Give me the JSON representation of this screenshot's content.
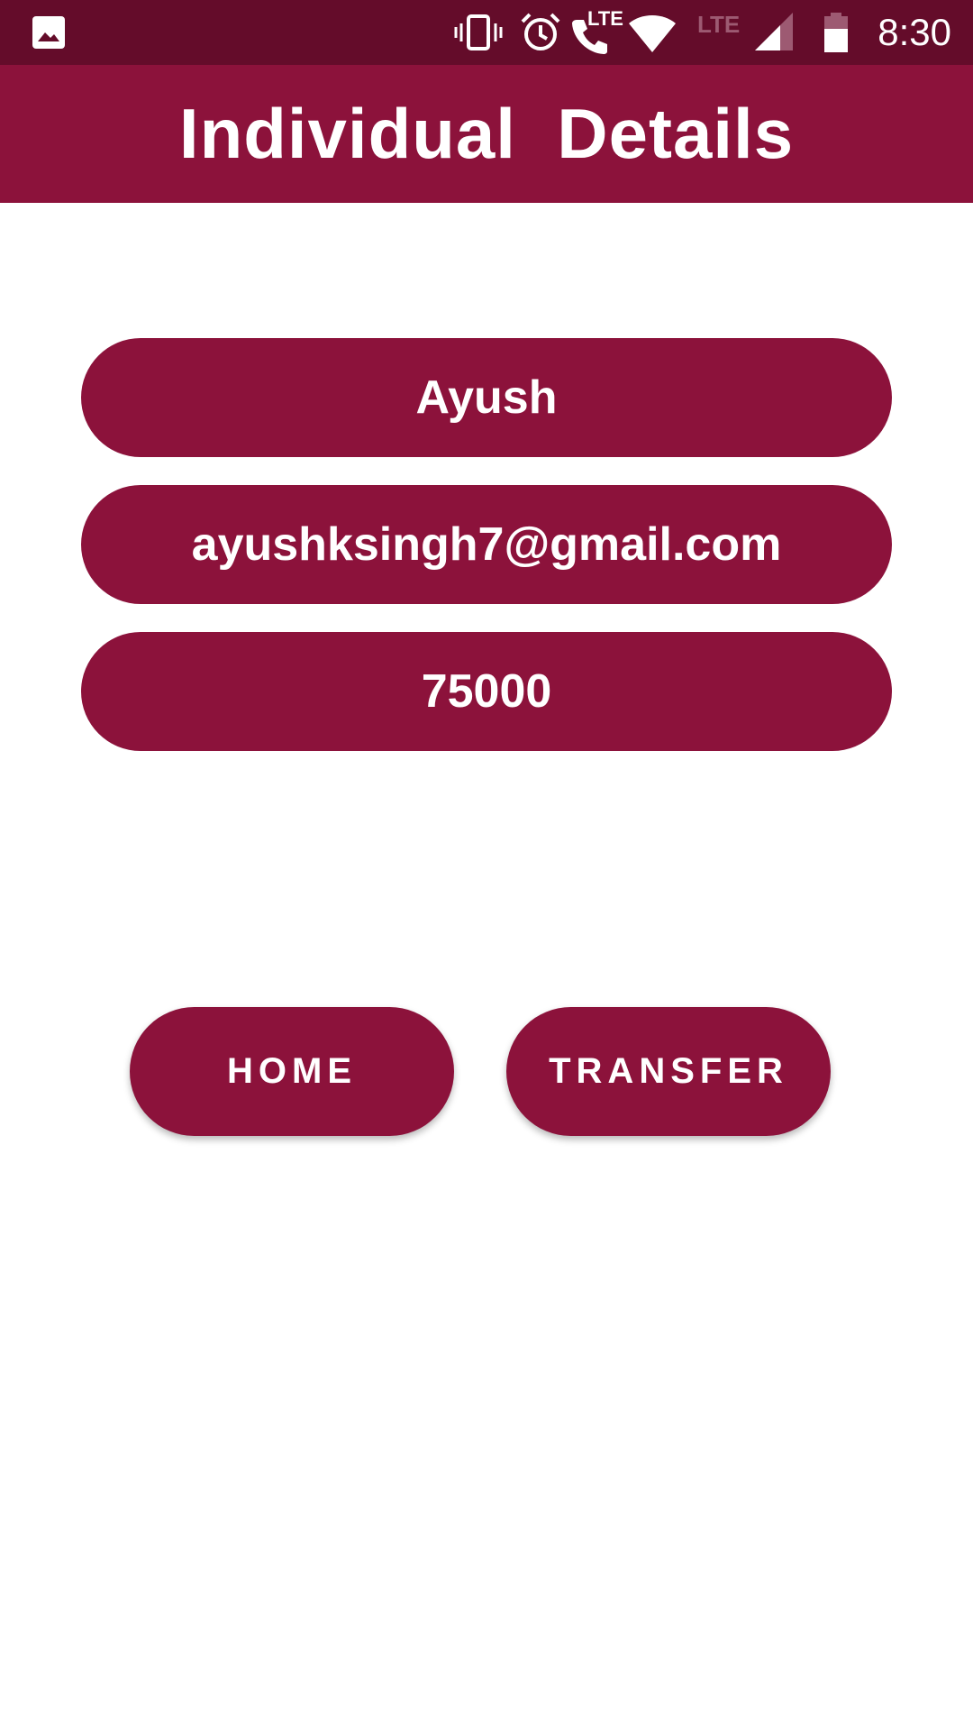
{
  "status_bar": {
    "time": "8:30",
    "lte_label": "LTE",
    "lte_label_secondary": "LTE",
    "icons": [
      "gallery-icon",
      "vibrate-icon",
      "alarm-icon",
      "lte-call-icon",
      "wifi-icon",
      "cell-signal-icon",
      "battery-icon"
    ]
  },
  "header": {
    "title": "Individual  Details"
  },
  "details": {
    "name": "Ayush",
    "email": "ayushksingh7@gmail.com",
    "amount": "75000"
  },
  "actions": {
    "home_label": "HOME",
    "transfer_label": "TRANSFER"
  },
  "colors": {
    "status_bar": "#640c2a",
    "primary": "#8c123b",
    "text_on_primary": "#ffffff",
    "background": "#ffffff"
  }
}
